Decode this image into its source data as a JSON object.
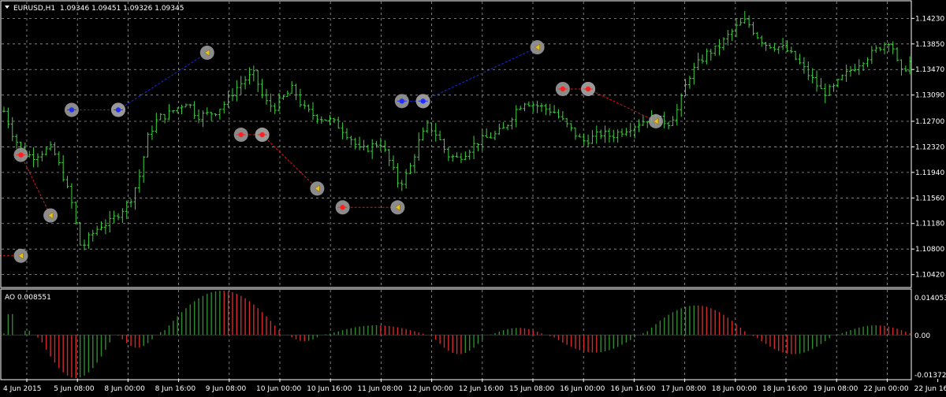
{
  "window": {
    "symbol": "EURUSD,H1",
    "ohlc": "1.09346 1.09451 1.09326 1.09345"
  },
  "indicator": {
    "label": "AO 0.008551",
    "scale": [
      "0.014053",
      "0.00",
      "-0.013726"
    ]
  },
  "colors": {
    "background": "#000000",
    "grid": "#cfcfcf",
    "candle_up": "#3fd13f",
    "candle_down": "#3fd13f",
    "ao_up": "#2e8b2e",
    "ao_down": "#d42a2a",
    "sell_line": "#d11a1a",
    "buy_line": "#1a2ad1",
    "axis_text": "#ffffff"
  },
  "chart_data": {
    "type": "candlestick",
    "price_axis_labels": [
      "1.14230",
      "1.13850",
      "1.13470",
      "1.13090",
      "1.12700",
      "1.12320",
      "1.11940",
      "1.11560",
      "1.11180",
      "1.10800",
      "1.10420"
    ],
    "price_range": [
      1.1024,
      1.1448
    ],
    "time_axis_labels": [
      "4 Jun 2015",
      "5 Jun 08:00",
      "8 Jun 00:00",
      "8 Jun 16:00",
      "9 Jun 08:00",
      "10 Jun 00:00",
      "10 Jun 16:00",
      "11 Jun 08:00",
      "12 Jun 00:00",
      "12 Jun 16:00",
      "15 Jun 08:00",
      "16 Jun 00:00",
      "16 Jun 16:00",
      "17 Jun 08:00",
      "18 Jun 00:00",
      "18 Jun 16:00",
      "19 Jun 08:00",
      "22 Jun 00:00",
      "22 Jun 16:"
    ],
    "close_path": [
      [
        0,
        1.1285
      ],
      [
        2,
        1.1248
      ],
      [
        4,
        1.1222
      ],
      [
        6,
        1.1218
      ],
      [
        8,
        1.1225
      ],
      [
        10,
        1.123
      ],
      [
        12,
        1.1195
      ],
      [
        14,
        1.115
      ],
      [
        16,
        1.108
      ],
      [
        18,
        1.11
      ],
      [
        20,
        1.1115
      ],
      [
        22,
        1.112
      ],
      [
        24,
        1.1135
      ],
      [
        26,
        1.115
      ],
      [
        28,
        1.1185
      ],
      [
        30,
        1.125
      ],
      [
        32,
        1.1275
      ],
      [
        34,
        1.128
      ],
      [
        36,
        1.129
      ],
      [
        38,
        1.13
      ],
      [
        40,
        1.1278
      ],
      [
        42,
        1.128
      ],
      [
        44,
        1.1285
      ],
      [
        46,
        1.1298
      ],
      [
        48,
        1.1318
      ],
      [
        50,
        1.1332
      ],
      [
        52,
        1.134
      ],
      [
        54,
        1.13
      ],
      [
        56,
        1.129
      ],
      [
        58,
        1.1305
      ],
      [
        60,
        1.132
      ],
      [
        62,
        1.129
      ],
      [
        64,
        1.128
      ],
      [
        66,
        1.1275
      ],
      [
        68,
        1.127
      ],
      [
        70,
        1.126
      ],
      [
        72,
        1.1245
      ],
      [
        74,
        1.1225
      ],
      [
        76,
        1.1232
      ],
      [
        78,
        1.124
      ],
      [
        80,
        1.121
      ],
      [
        82,
        1.1175
      ],
      [
        84,
        1.1195
      ],
      [
        86,
        1.1238
      ],
      [
        88,
        1.1265
      ],
      [
        90,
        1.1248
      ],
      [
        92,
        1.122
      ],
      [
        94,
        1.1215
      ],
      [
        96,
        1.1225
      ],
      [
        98,
        1.1238
      ],
      [
        100,
        1.1245
      ],
      [
        102,
        1.125
      ],
      [
        104,
        1.126
      ],
      [
        106,
        1.1285
      ],
      [
        108,
        1.13
      ],
      [
        110,
        1.1295
      ],
      [
        112,
        1.129
      ],
      [
        114,
        1.1285
      ],
      [
        116,
        1.127
      ],
      [
        118,
        1.1255
      ],
      [
        120,
        1.124
      ],
      [
        122,
        1.1245
      ],
      [
        124,
        1.1252
      ],
      [
        126,
        1.1248
      ],
      [
        128,
        1.1255
      ],
      [
        130,
        1.1262
      ],
      [
        132,
        1.1268
      ],
      [
        134,
        1.1275
      ],
      [
        136,
        1.1272
      ],
      [
        138,
        1.1268
      ],
      [
        140,
        1.129
      ],
      [
        142,
        1.1335
      ],
      [
        144,
        1.1355
      ],
      [
        146,
        1.1372
      ],
      [
        148,
        1.1378
      ],
      [
        150,
        1.1395
      ],
      [
        152,
        1.141
      ],
      [
        154,
        1.142
      ],
      [
        156,
        1.14
      ],
      [
        158,
        1.1385
      ],
      [
        160,
        1.1382
      ],
      [
        162,
        1.1378
      ],
      [
        164,
        1.1365
      ],
      [
        166,
        1.1348
      ],
      [
        168,
        1.133
      ],
      [
        170,
        1.1312
      ],
      [
        172,
        1.1318
      ],
      [
        174,
        1.1335
      ],
      [
        176,
        1.1348
      ],
      [
        178,
        1.136
      ],
      [
        180,
        1.137
      ],
      [
        182,
        1.1382
      ],
      [
        184,
        1.1392
      ],
      [
        186,
        1.134
      ],
      [
        188,
        1.1358
      ]
    ],
    "trade_markers": [
      {
        "type": "sell",
        "open_time_index": 4,
        "open_price": 1.122,
        "close_time_index": 11,
        "close_price": 1.113,
        "color": "red"
      },
      {
        "type": "buy",
        "open_time_index": 16,
        "open_price": 1.1287,
        "close_time_index": 27,
        "close_price": 1.1287,
        "color": "blue"
      },
      {
        "type": "buy",
        "open_time_index": 27,
        "open_price": 1.1287,
        "close_time_index": 48,
        "close_price": 1.1372,
        "color": "blue"
      },
      {
        "type": "sell",
        "open_time_index": 56,
        "open_price": 1.125,
        "close_time_index": 61,
        "close_price": 1.125,
        "color": "red"
      },
      {
        "type": "sell",
        "open_time_index": 61,
        "open_price": 1.125,
        "close_time_index": 74,
        "close_price": 1.117,
        "color": "red"
      },
      {
        "type": "sell",
        "open_time_index": 80,
        "open_price": 1.1142,
        "close_time_index": 93,
        "close_price": 1.1142,
        "color": "red"
      },
      {
        "type": "buy",
        "open_time_index": 94,
        "open_price": 1.13,
        "close_time_index": 99,
        "close_price": 1.13,
        "color": "blue"
      },
      {
        "type": "buy",
        "open_time_index": 99,
        "open_price": 1.13,
        "close_time_index": 126,
        "close_price": 1.138,
        "color": "blue"
      },
      {
        "type": "sell",
        "open_time_index": 132,
        "open_price": 1.1318,
        "close_time_index": 138,
        "close_price": 1.1318,
        "color": "red"
      },
      {
        "type": "sell",
        "open_time_index": 138,
        "open_price": 1.1318,
        "close_time_index": 154,
        "close_price": 1.127,
        "color": "red"
      },
      {
        "type": "sell",
        "open_time_index": -3,
        "open_price": 1.107,
        "close_time_index": 4,
        "close_price": 1.107,
        "color": "red"
      }
    ],
    "ao_scale": [
      -0.013726,
      0.014053
    ],
    "ao_segments": [
      {
        "from": 0,
        "to": 3,
        "peak": 0.0075
      },
      {
        "from": 4,
        "to": 7,
        "peak": 0.0015
      },
      {
        "from": 8,
        "to": 26,
        "peak": -0.0135
      },
      {
        "from": 27,
        "to": 36,
        "peak": -0.004
      },
      {
        "from": 37,
        "to": 66,
        "peak": 0.0138
      },
      {
        "from": 67,
        "to": 75,
        "peak": -0.002
      },
      {
        "from": 76,
        "to": 100,
        "peak": 0.003
      },
      {
        "from": 101,
        "to": 114,
        "peak": -0.006
      },
      {
        "from": 115,
        "to": 128,
        "peak": 0.0022
      },
      {
        "from": 129,
        "to": 150,
        "peak": -0.0055
      },
      {
        "from": 151,
        "to": 176,
        "peak": 0.0092
      },
      {
        "from": 177,
        "to": 196,
        "peak": -0.006
      },
      {
        "from": 197,
        "to": 215,
        "peak": 0.003
      }
    ]
  }
}
